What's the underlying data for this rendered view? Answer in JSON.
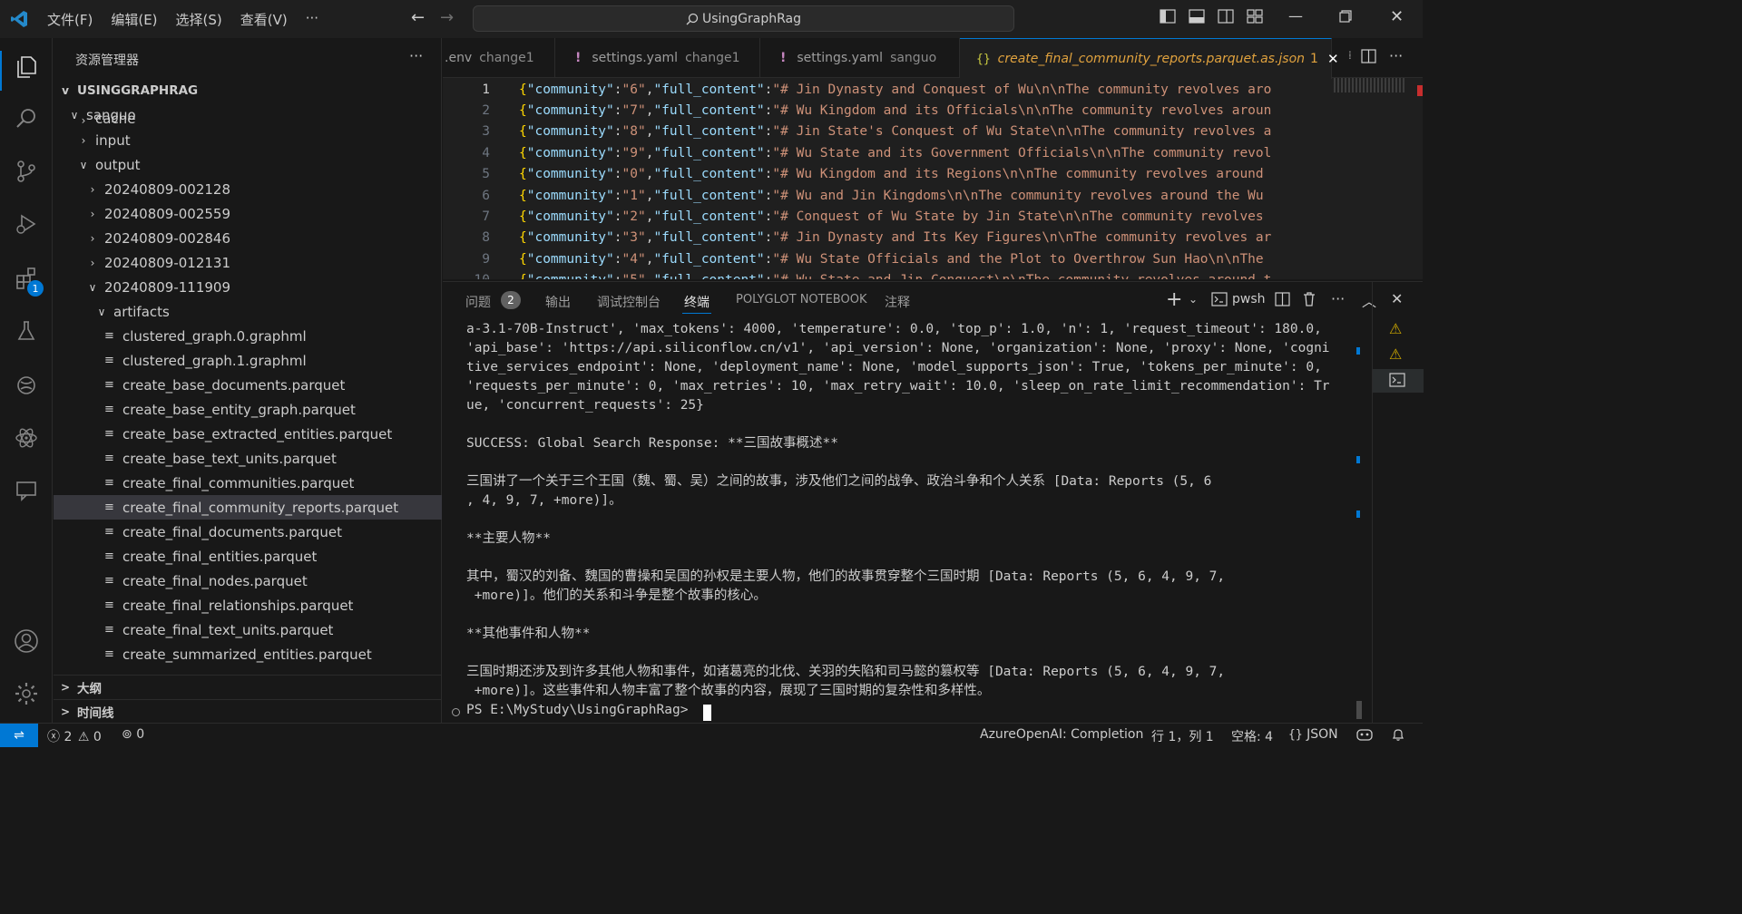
{
  "menu": [
    "文件(F)",
    "编辑(E)",
    "选择(S)",
    "查看(V)",
    "···"
  ],
  "search": {
    "text": "UsingGraphRag"
  },
  "sidebar": {
    "title": "资源管理器",
    "root": "USINGGRAPHRAG",
    "items": [
      {
        "label": "sanguo",
        "chev": "v"
      },
      {
        "label": "cache",
        "chev": ">"
      },
      {
        "label": "input",
        "chev": ">"
      },
      {
        "label": "output",
        "chev": "v"
      },
      {
        "label": "20240809-002128",
        "chev": ">"
      },
      {
        "label": "20240809-002559",
        "chev": ">"
      },
      {
        "label": "20240809-002846",
        "chev": ">"
      },
      {
        "label": "20240809-012131",
        "chev": ">"
      },
      {
        "label": "20240809-111909",
        "chev": "v"
      },
      {
        "label": "artifacts",
        "chev": "v"
      },
      {
        "label": "clustered_graph.0.graphml"
      },
      {
        "label": "clustered_graph.1.graphml"
      },
      {
        "label": "create_base_documents.parquet"
      },
      {
        "label": "create_base_entity_graph.parquet"
      },
      {
        "label": "create_base_extracted_entities.parquet"
      },
      {
        "label": "create_base_text_units.parquet"
      },
      {
        "label": "create_final_communities.parquet"
      },
      {
        "label": "create_final_community_reports.parquet"
      },
      {
        "label": "create_final_documents.parquet"
      },
      {
        "label": "create_final_entities.parquet"
      },
      {
        "label": "create_final_nodes.parquet"
      },
      {
        "label": "create_final_relationships.parquet"
      },
      {
        "label": "create_final_text_units.parquet"
      },
      {
        "label": "create_summarized_entities.parquet"
      }
    ],
    "outline": "大纲",
    "timeline": "时间线"
  },
  "tabs": [
    {
      "name": ".env",
      "sub": "change1"
    },
    {
      "name": "settings.yaml",
      "sub": "change1"
    },
    {
      "name": "settings.yaml",
      "sub": "sanguo"
    },
    {
      "name": "create_final_community_reports.parquet.as.json",
      "badge": "1"
    }
  ],
  "code": [
    {
      "n": "1",
      "c": "6",
      "t": "# Jin Dynasty and Conquest of Wu\\n\\nThe community revolves aro"
    },
    {
      "n": "2",
      "c": "7",
      "t": "# Wu Kingdom and its Officials\\n\\nThe community revolves aroun"
    },
    {
      "n": "3",
      "c": "8",
      "t": "# Jin State's Conquest of Wu State\\n\\nThe community revolves a"
    },
    {
      "n": "4",
      "c": "9",
      "t": "# Wu State and its Government Officials\\n\\nThe community revol"
    },
    {
      "n": "5",
      "c": "0",
      "t": "# Wu Kingdom and its Regions\\n\\nThe community revolves around "
    },
    {
      "n": "6",
      "c": "1",
      "t": "# Wu and Jin Kingdoms\\n\\nThe community revolves around the Wu "
    },
    {
      "n": "7",
      "c": "2",
      "t": "# Conquest of Wu State by Jin State\\n\\nThe community revolves "
    },
    {
      "n": "8",
      "c": "3",
      "t": "# Jin Dynasty and Its Key Figures\\n\\nThe community revolves ar"
    },
    {
      "n": "9",
      "c": "4",
      "t": "# Wu State Officials and the Plot to Overthrow Sun Hao\\n\\nThe "
    },
    {
      "n": "10",
      "c": "5",
      "t": "# Wu State and Jin Conquest\\n\\nThe community revolves around t"
    }
  ],
  "code_key_community": "\"community\"",
  "code_key_full": "\"full_content\"",
  "panel": {
    "tabs": [
      "问题",
      "输出",
      "调试控制台",
      "终端",
      "POLYGLOT NOTEBOOK",
      "注释"
    ],
    "problems_count": "2",
    "shell": "pwsh"
  },
  "terminal": [
    "a-3.1-70B-Instruct', 'max_tokens': 4000, 'temperature': 0.0, 'top_p': 1.0, 'n': 1, 'request_timeout': 180.0,",
    "'api_base': 'https://api.siliconflow.cn/v1', 'api_version': None, 'organization': None, 'proxy': None, 'cogni",
    "tive_services_endpoint': None, 'deployment_name': None, 'model_supports_json': True, 'tokens_per_minute': 0,",
    "'requests_per_minute': 0, 'max_retries': 10, 'max_retry_wait': 10.0, 'sleep_on_rate_limit_recommendation': Tr",
    "ue, 'concurrent_requests': 25}",
    "",
    "SUCCESS: Global Search Response: **三国故事概述**",
    "",
    "三国讲了一个关于三个王国（魏、蜀、吴）之间的故事，涉及他们之间的战争、政治斗争和个人关系 [Data: Reports (5, 6",
    ", 4, 9, 7, +more)]。",
    "",
    "**主要人物**",
    "",
    "其中，蜀汉的刘备、魏国的曹操和吴国的孙权是主要人物，他们的故事贯穿整个三国时期 [Data: Reports (5, 6, 4, 9, 7,",
    " +more)]。他们的关系和斗争是整个故事的核心。",
    "",
    "**其他事件和人物**",
    "",
    "三国时期还涉及到许多其他人物和事件，如诸葛亮的北伐、关羽的失陷和司马懿的篡权等 [Data: Reports (5, 6, 4, 9, 7,",
    " +more)]。这些事件和人物丰富了整个故事的内容，展现了三国时期的复杂性和多样性。",
    "PS E:\\MyStudy\\UsingGraphRag> "
  ],
  "status": {
    "errors": "2",
    "warnings": "0",
    "ports": "0",
    "mode": "AzureOpenAI: Completion",
    "position": "行 1，列 1",
    "spaces": "空格: 4",
    "language": "JSON"
  },
  "badges": {
    "extensions": "1"
  },
  "colors": {
    "accent": "#0078d4",
    "selection": "#37373d",
    "warning": "#cca700",
    "key": "#9cdcfe",
    "string": "#ce9178"
  }
}
